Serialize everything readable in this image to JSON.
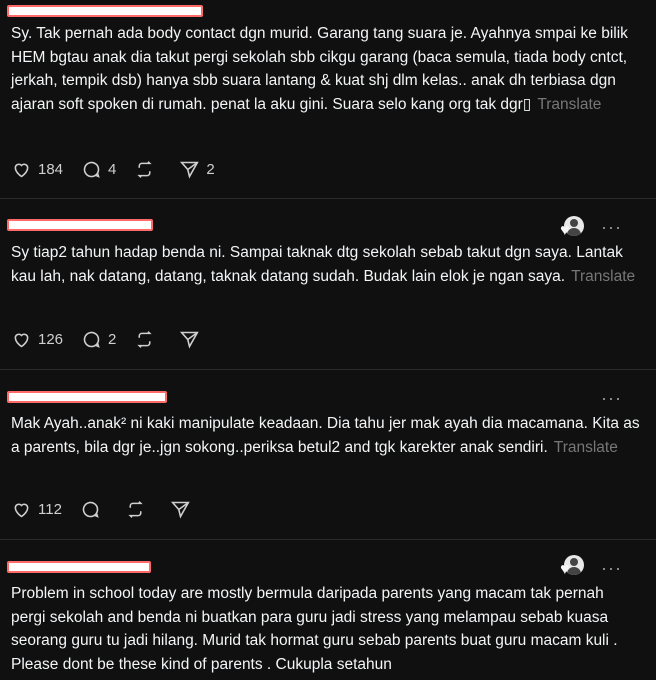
{
  "posts": [
    {
      "text": "Sy. Tak pernah ada body contact dgn murid. Garang tang suara je. Ayahnya smpai ke bilik HEM bgtau anak dia takut pergi sekolah sbb cikgu garang (baca semula, tiada body cntct, jerkah, tempik dsb) hanya sbb suara lantang & kuat shj dlm kelas.. anak dh terbiasa dgn ajaran soft spoken di rumah. penat la aku gini. Suara selo kang org tak dgr▯",
      "translate": "Translate",
      "likes": "184",
      "replies": "4",
      "reposts": "",
      "shares": "2"
    },
    {
      "text": "Sy tiap2 tahun hadap benda ni. Sampai taknak dtg sekolah sebab takut dgn saya. Lantak kau lah, nak datang, datang, taknak datang sudah. Budak lain elok je ngan saya.",
      "translate": "Translate",
      "likes": "126",
      "replies": "2",
      "reposts": "",
      "shares": ""
    },
    {
      "text": "Mak Ayah..anak² ni kaki manipulate keadaan. Dia tahu jer mak ayah dia macamana. Kita as a parents, bila dgr je..jgn sokong..periksa betul2 and tgk karekter anak sendiri.",
      "translate": "Translate",
      "likes": "112",
      "replies": "",
      "reposts": "",
      "shares": ""
    },
    {
      "text": "Problem in school today are mostly bermula daripada parents yang macam tak pernah pergi sekolah and benda ni buatkan para guru jadi stress yang melampau sebab kuasa seorang guru tu jadi hilang. Murid tak hormat guru sebab parents buat guru macam kuli . Please dont be these kind of parents . Cukupla setahun",
      "translate": "",
      "likes": "",
      "replies": "",
      "reposts": "",
      "shares": ""
    }
  ],
  "icons": {
    "more": "more-icon",
    "like": "heart-icon",
    "reply": "comment-icon",
    "repost": "repost-icon",
    "share": "send-icon"
  },
  "colors": {
    "background": "#101010",
    "text": "#f3f5f7",
    "muted": "#777777",
    "redaction_border": "#ff6b6b",
    "liked_heart": "#ff3040"
  }
}
